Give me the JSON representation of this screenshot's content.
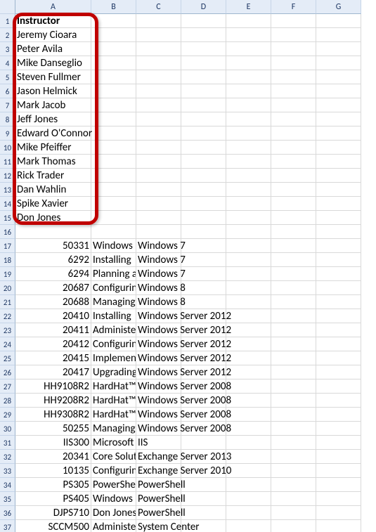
{
  "columns": [
    "A",
    "B",
    "C",
    "D",
    "E",
    "F",
    "G"
  ],
  "col_widths": {
    "A": 108,
    "B": 64,
    "C": 64,
    "D": 64,
    "E": 64,
    "F": 64,
    "G": 64
  },
  "header_cell": {
    "row": 1,
    "col": "A",
    "value": "Instructor",
    "bold": true
  },
  "instructors": [
    "Jeremy Cioara",
    "Peter Avila",
    "Mike Danseglio",
    "Steven Fullmer",
    "Jason Helmick",
    "Mark Jacob",
    "Jeff Jones",
    "Edward O'Connor",
    "Mike Pfeiffer",
    "Mark Thomas",
    "Rick Trader",
    "Dan Wahlin",
    "Spike Xavier",
    "Don Jones"
  ],
  "gap_rows": [
    16
  ],
  "courses_start_row": 17,
  "courses": [
    {
      "code": "50331",
      "b": "Windows",
      "c": "Windows 7"
    },
    {
      "code": "6292",
      "b": "Installing",
      "c": "Windows 7"
    },
    {
      "code": "6294",
      "b": "Planning a",
      "c": "Windows 7"
    },
    {
      "code": "20687",
      "b": "Configurin",
      "c": "Windows 8"
    },
    {
      "code": "20688",
      "b": "Managing",
      "c": "Windows 8"
    },
    {
      "code": "20410",
      "b": "Installing",
      "c": "Windows Server 2012"
    },
    {
      "code": "20411",
      "b": "Administe",
      "c": "Windows Server 2012"
    },
    {
      "code": "20412",
      "b": "Configurin",
      "c": "Windows Server 2012"
    },
    {
      "code": "20415",
      "b": "Implemen",
      "c": "Windows Server 2012"
    },
    {
      "code": "20417",
      "b": "Upgrading",
      "c": "Windows Server 2012"
    },
    {
      "code": "HH9108R2",
      "b": "HardHat™",
      "c": "Windows Server 2008"
    },
    {
      "code": "HH9208R2",
      "b": "HardHat™",
      "c": "Windows Server 2008"
    },
    {
      "code": "HH9308R2",
      "b": "HardHat™",
      "c": "Windows Server 2008"
    },
    {
      "code": "50255",
      "b": "Managing",
      "c": "Windows Server 2008"
    },
    {
      "code": "IIS300",
      "b": "Microsoft",
      "c": "IIS"
    },
    {
      "code": "20341",
      "b": "Core Solut",
      "c": "Exchange Server 2013"
    },
    {
      "code": "10135",
      "b": "Configurin",
      "c": "Exchange Server 2010"
    },
    {
      "code": "PS305",
      "b": "PowerShe",
      "c": "PowerShell"
    },
    {
      "code": "PS405",
      "b": "Windows",
      "c": "PowerShell"
    },
    {
      "code": "DJPS710",
      "b": "Don Jones",
      "c": "PowerShell"
    },
    {
      "code": "SCCM500",
      "b": "Administe",
      "c": "System Center"
    }
  ],
  "callout": {
    "top_row": 1,
    "left_col": "A",
    "bottom_row": 15,
    "right_col": "A",
    "color": "#c00000"
  }
}
